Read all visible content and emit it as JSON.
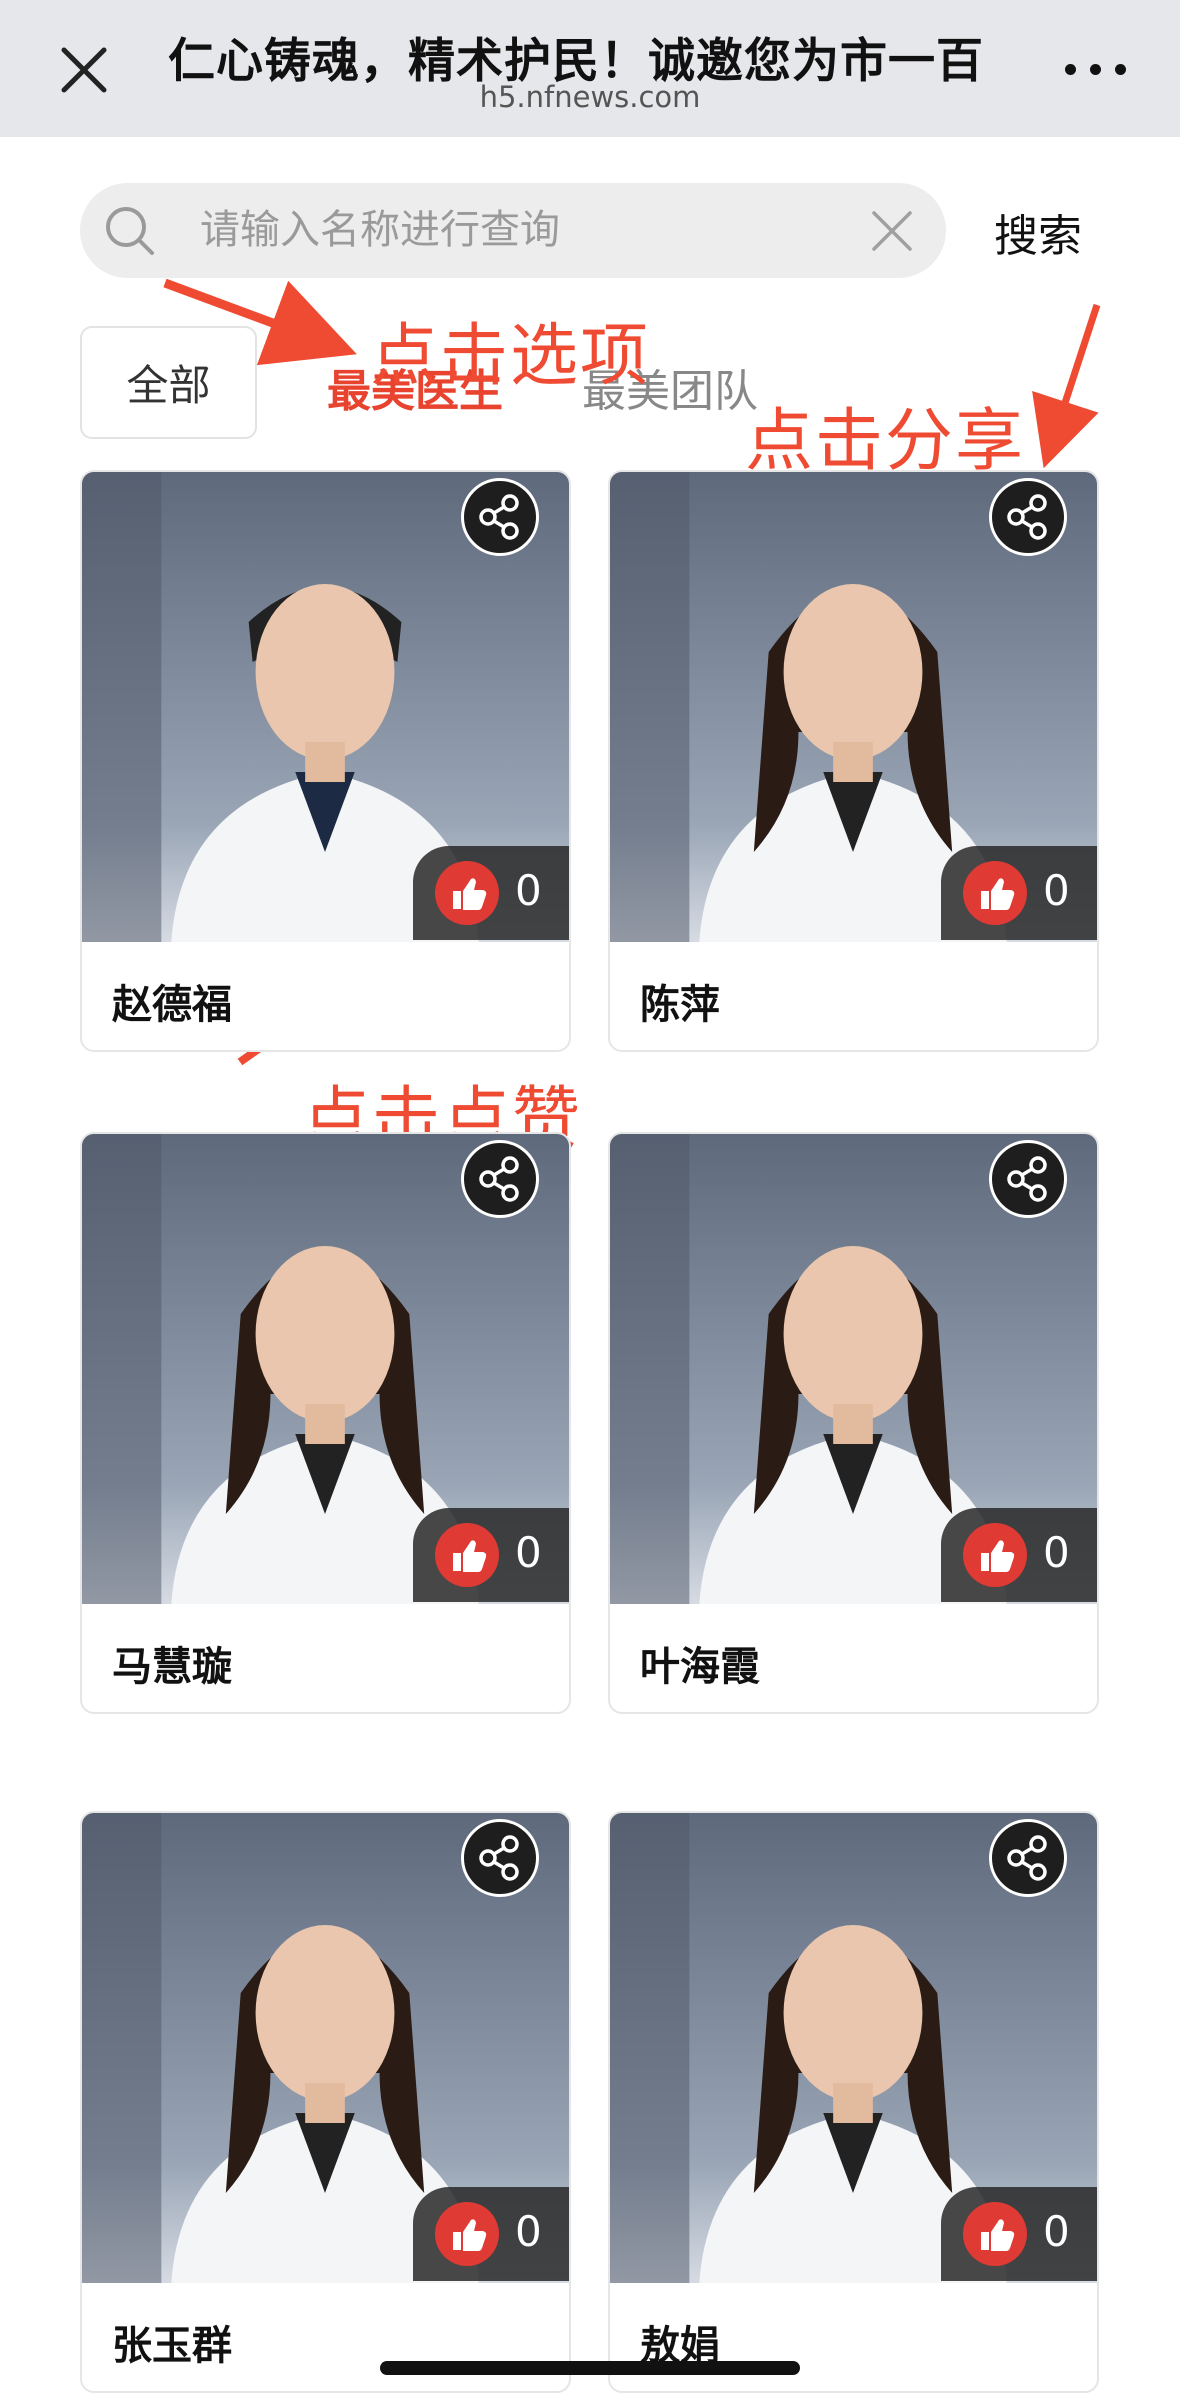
{
  "header": {
    "title": "仁心铸魂，精术护民！诚邀您为市一百",
    "subtitle": "h5.nfnews.com"
  },
  "search": {
    "placeholder": "请输入名称进行查询",
    "button_label": "搜索"
  },
  "tabs": [
    {
      "label": "全部",
      "active": false
    },
    {
      "label": "最美医生",
      "active": true
    },
    {
      "label": "最美团队",
      "active": false
    }
  ],
  "annotations": {
    "tap_option": "点击选项",
    "tap_share": "点击分享",
    "tap_like": "点击点赞"
  },
  "cards": [
    {
      "name": "赵德福",
      "likes": "0",
      "gender": "m"
    },
    {
      "name": "陈萍",
      "likes": "0",
      "gender": "f"
    },
    {
      "name": "马慧璇",
      "likes": "0",
      "gender": "f"
    },
    {
      "name": "叶海霞",
      "likes": "0",
      "gender": "f"
    },
    {
      "name": "张玉群",
      "likes": "0",
      "gender": "f"
    },
    {
      "name": "敖娟",
      "likes": "0",
      "gender": "f"
    }
  ],
  "colors": {
    "accent": "#e8432f",
    "like": "#e03a34",
    "annotation": "#ef4b33"
  }
}
